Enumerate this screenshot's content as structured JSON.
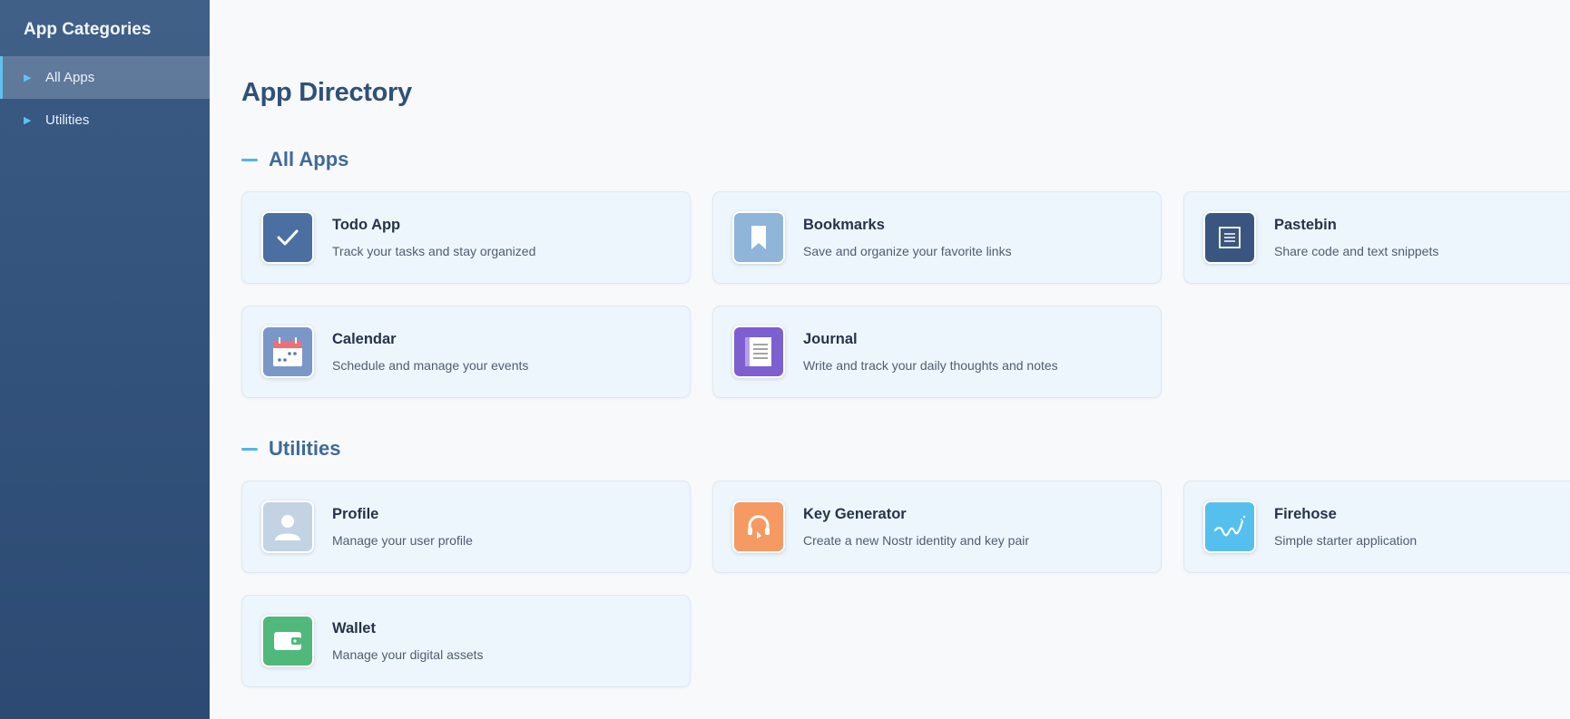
{
  "sidebar": {
    "title": "App Categories",
    "items": [
      {
        "label": "All Apps",
        "active": true
      },
      {
        "label": "Utilities",
        "active": false
      }
    ]
  },
  "main": {
    "title": "App Directory",
    "sections": [
      {
        "title": "All Apps",
        "apps": [
          {
            "name": "Todo App",
            "description": "Track your tasks and stay organized",
            "icon": "checkmark-icon",
            "color": "#4a6fa0"
          },
          {
            "name": "Bookmarks",
            "description": "Save and organize your favorite links",
            "icon": "bookmark-icon",
            "color": "#8fb5d8"
          },
          {
            "name": "Pastebin",
            "description": "Share code and text snippets",
            "icon": "document-icon",
            "color": "#3a5680"
          },
          {
            "name": "Calendar",
            "description": "Schedule and manage your events",
            "icon": "calendar-icon",
            "color": "#7b97c8"
          },
          {
            "name": "Journal",
            "description": "Write and track your daily thoughts and notes",
            "icon": "notebook-icon",
            "color": "#7e5fcf"
          }
        ]
      },
      {
        "title": "Utilities",
        "apps": [
          {
            "name": "Profile",
            "description": "Manage your user profile",
            "icon": "user-icon",
            "color": "#c4d3e4"
          },
          {
            "name": "Key Generator",
            "description": "Create a new Nostr identity and key pair",
            "icon": "key-icon",
            "color": "#f59a63"
          },
          {
            "name": "Firehose",
            "description": "Simple starter application",
            "icon": "squiggle-icon",
            "color": "#55c0ee"
          },
          {
            "name": "Wallet",
            "description": "Manage your digital assets",
            "icon": "wallet-icon",
            "color": "#4fb87a"
          }
        ]
      }
    ]
  }
}
